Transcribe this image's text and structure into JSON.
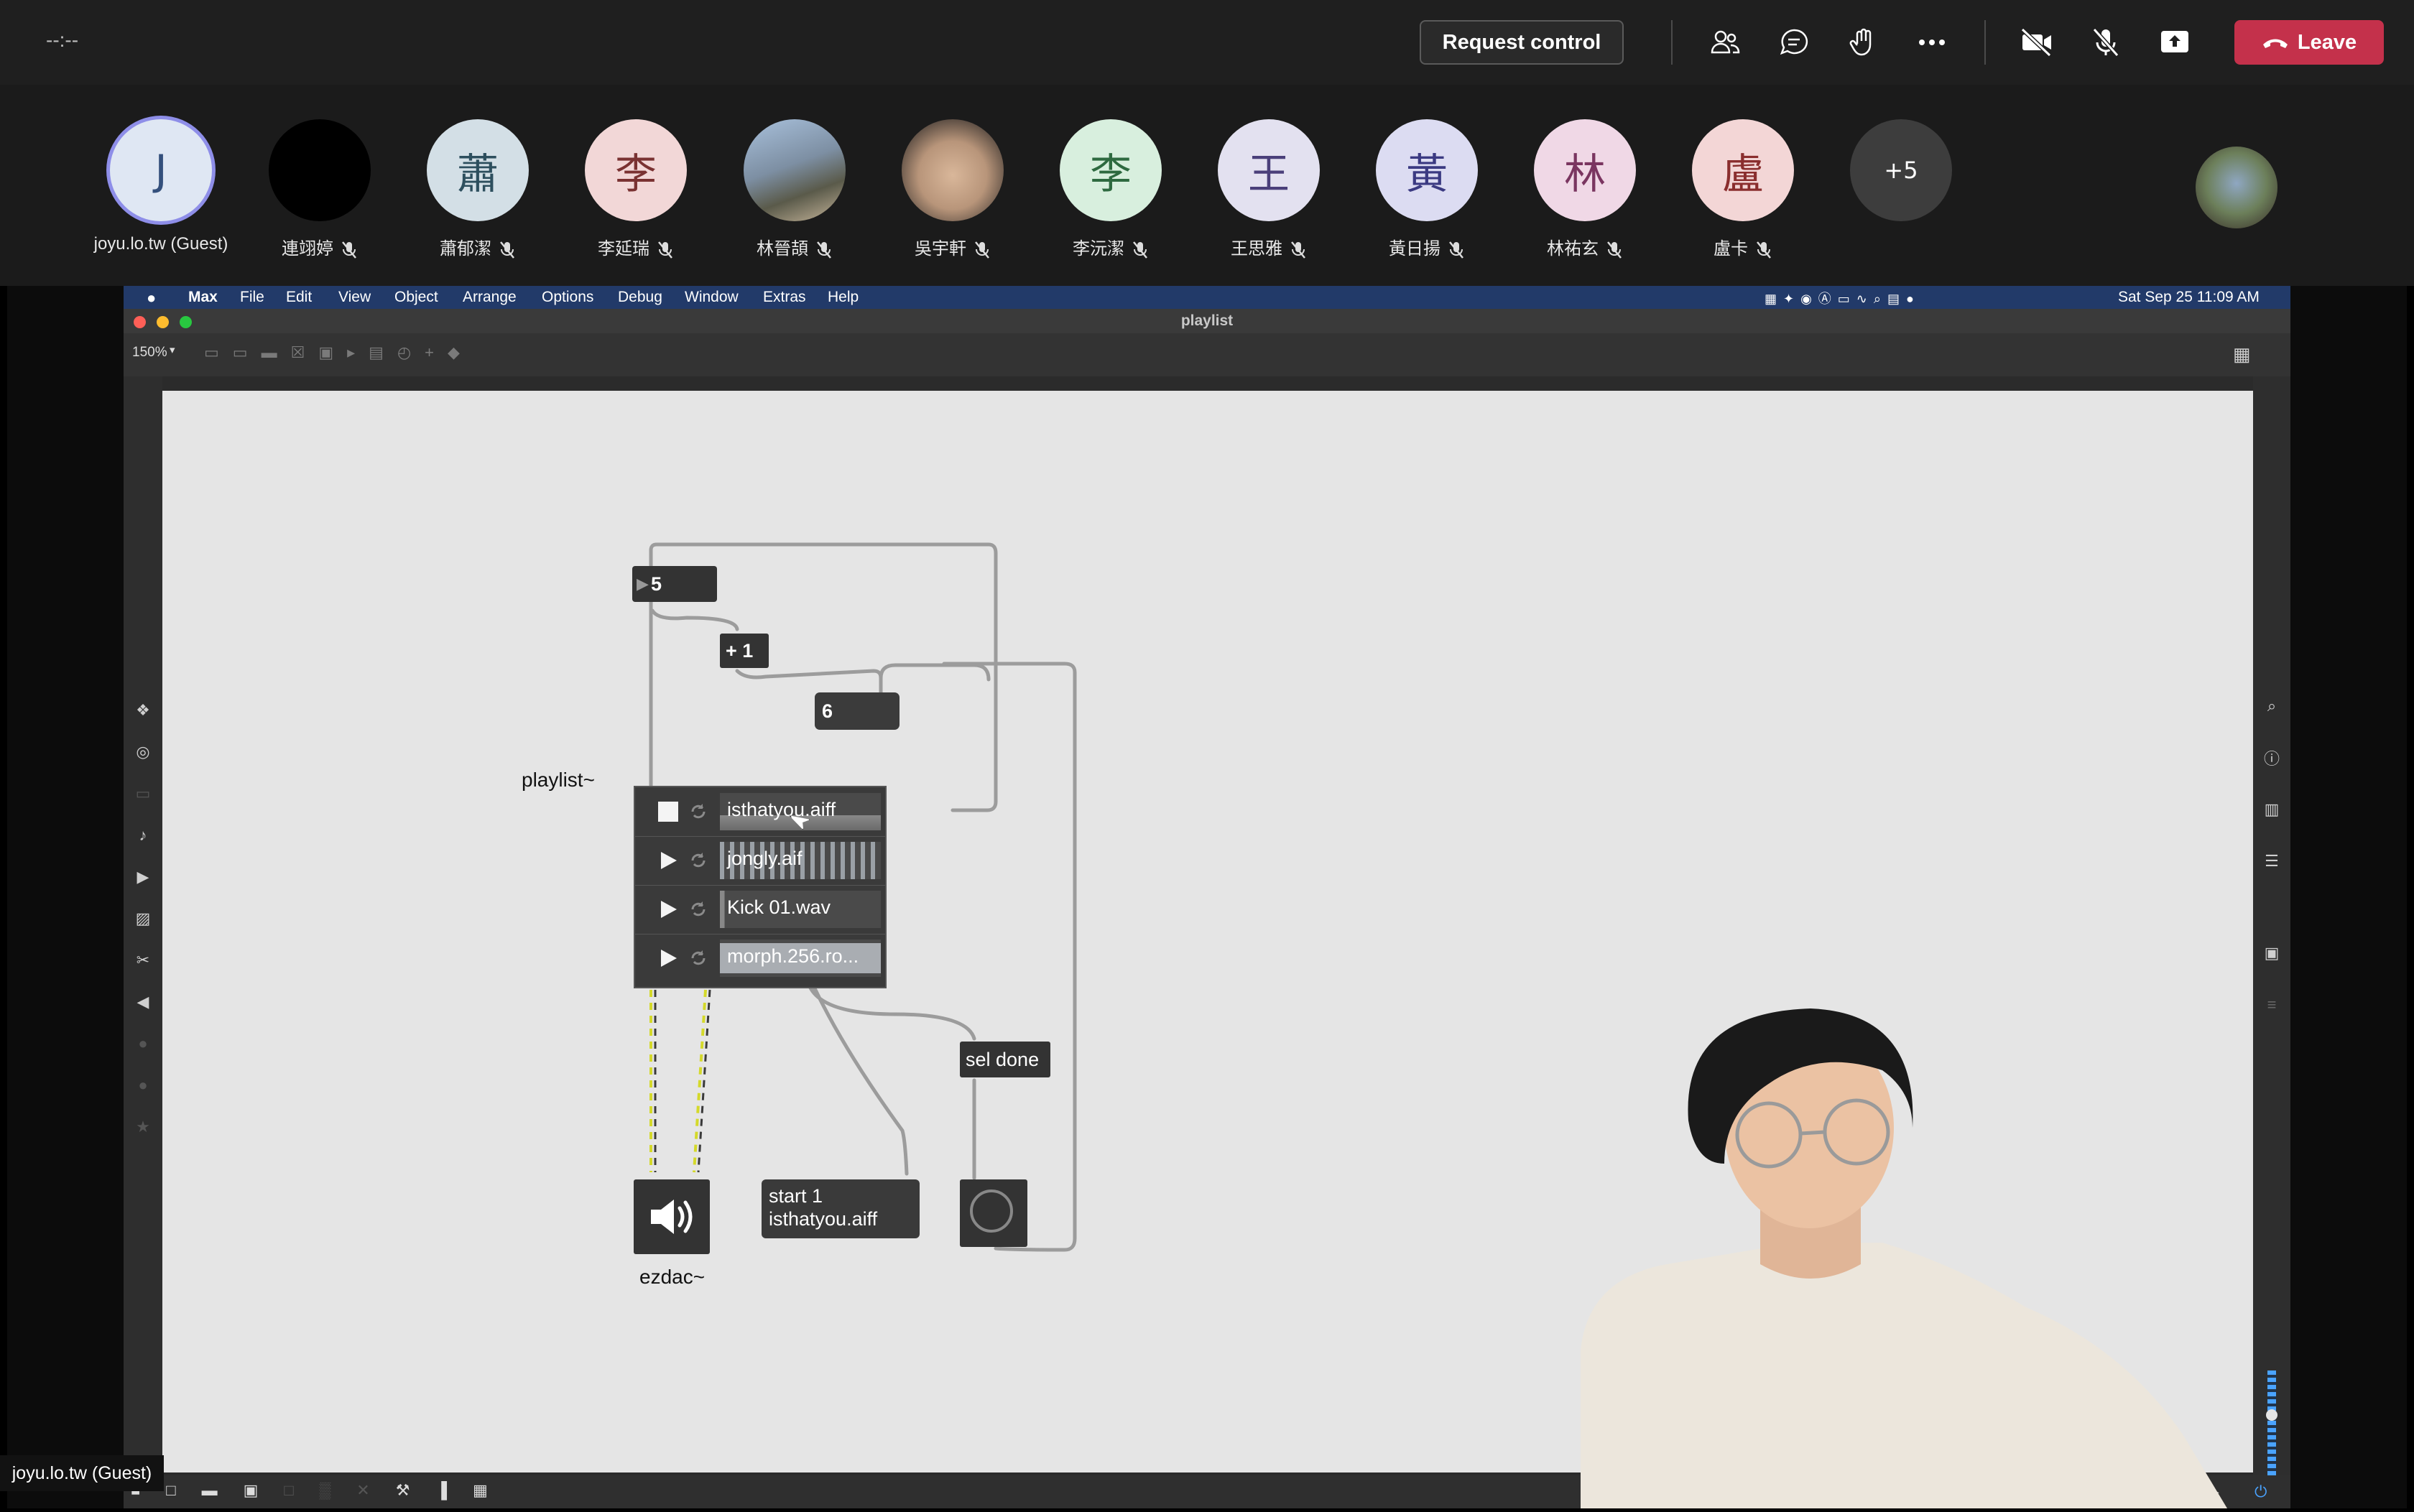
{
  "meeting": {
    "timer": "--:--",
    "request_control_label": "Request control",
    "leave_label": "Leave",
    "toolbar_icons": [
      "people-icon",
      "chat-icon",
      "raise-hand-icon",
      "more-icon",
      "camera-off-icon",
      "mic-off-icon",
      "share-icon"
    ]
  },
  "participants": [
    {
      "initial": "J",
      "name": "joyu.lo.tw (Guest)",
      "bg": "#dfe7f3",
      "fg": "#34507c",
      "muted": false,
      "highlight": true
    },
    {
      "initial": "",
      "name": "連翊婷",
      "bg": "#000000",
      "fg": "#ffffff",
      "muted": true
    },
    {
      "initial": "蕭",
      "name": "蕭郁潔",
      "bg": "#d3dfe6",
      "fg": "#2d4f5e",
      "muted": true
    },
    {
      "initial": "李",
      "name": "李延瑞",
      "bg": "#f2d7d7",
      "fg": "#7a3232",
      "muted": true
    },
    {
      "initial": "",
      "name": "林晉頡",
      "bg": "#7d8fa3",
      "fg": "#ffffff",
      "muted": true,
      "photo": true
    },
    {
      "initial": "",
      "name": "吳宇軒",
      "bg": "#9c8876",
      "fg": "#ffffff",
      "muted": true,
      "photo": true
    },
    {
      "initial": "李",
      "name": "李沅潔",
      "bg": "#d8efde",
      "fg": "#2e6a40",
      "muted": true
    },
    {
      "initial": "王",
      "name": "王思雅",
      "bg": "#e3e1f0",
      "fg": "#4a3f7a",
      "muted": true
    },
    {
      "initial": "黃",
      "name": "黃日揚",
      "bg": "#dcdcf2",
      "fg": "#3b3a82",
      "muted": true
    },
    {
      "initial": "林",
      "name": "林祐玄",
      "bg": "#f0d8e6",
      "fg": "#7a3560",
      "muted": true
    },
    {
      "initial": "盧",
      "name": "盧卡",
      "bg": "#f3d6d6",
      "fg": "#8a2e2e",
      "muted": true
    }
  ],
  "overflow_label": "+5",
  "macos_menubar": {
    "items": [
      "Max",
      "File",
      "Edit",
      "View",
      "Object",
      "Arrange",
      "Options",
      "Debug",
      "Window",
      "Extras",
      "Help"
    ],
    "datetime": "Sat Sep 25  11:09 AM"
  },
  "window": {
    "title": "playlist",
    "zoom": "150%"
  },
  "patch": {
    "number_box_1": "5",
    "plus_object": "+ 1",
    "number_box_2": "6",
    "playlist_label": "playlist~",
    "tracks": [
      {
        "name": "isthatyou.aiff",
        "state": "stop"
      },
      {
        "name": "jongly.aif",
        "state": "play"
      },
      {
        "name": "Kick 01.wav",
        "state": "play"
      },
      {
        "name": "morph.256.ro...",
        "state": "play"
      }
    ],
    "sel_object": "sel done",
    "message_line1": "start 1",
    "message_line2": "isthatyou.aiff",
    "ezdac_label": "ezdac~"
  },
  "presenter_name": "joyu.lo.tw (Guest)"
}
